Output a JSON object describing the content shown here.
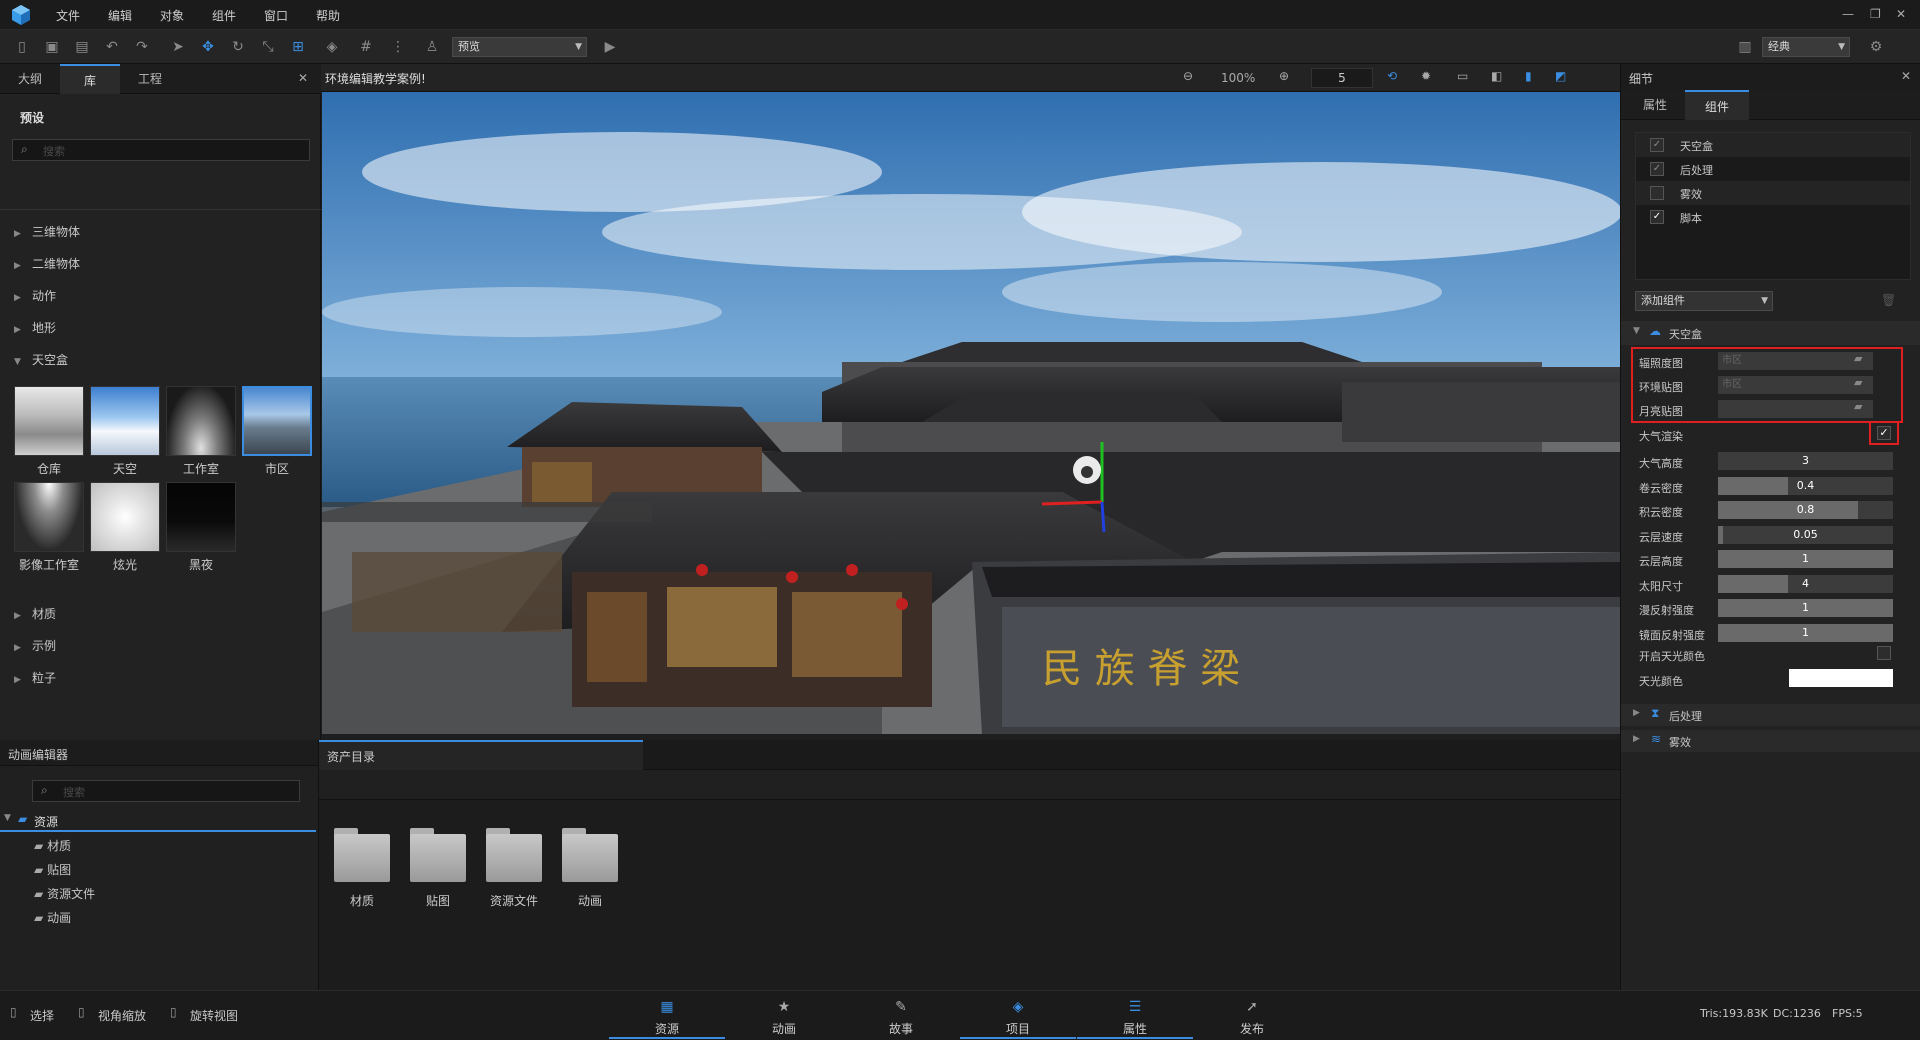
{
  "menubar": {
    "items": [
      "文件",
      "编辑",
      "对象",
      "组件",
      "窗口",
      "帮助"
    ]
  },
  "toolbar": {
    "preview_dropdown": "预览",
    "layout_dropdown": "经典"
  },
  "left_panel": {
    "tabs": [
      "大纲",
      "库",
      "工程"
    ],
    "section_title": "预设",
    "search_placeholder": "搜索",
    "categories_top": [
      "三维物体",
      "二维物体",
      "动作",
      "地形",
      "天空盒"
    ],
    "skybox_items": [
      "仓库",
      "天空",
      "工作室",
      "市区",
      "影像工作室",
      "炫光",
      "黑夜"
    ],
    "categories_bottom": [
      "材质",
      "示例",
      "粒子"
    ]
  },
  "viewport": {
    "title": "环境编辑教学案例!",
    "zoom": "100%",
    "speed": "5",
    "sign_text": "民 族 脊 梁"
  },
  "anim_editor": {
    "title": "动画编辑器",
    "search_placeholder": "搜索",
    "tree_root": "资源",
    "tree_children": [
      "材质",
      "贴图",
      "资源文件",
      "动画"
    ]
  },
  "assets": {
    "title": "资产目录",
    "folders": [
      "材质",
      "贴图",
      "资源文件",
      "动画"
    ]
  },
  "right_panel": {
    "title": "细节",
    "tabs": [
      "属性",
      "组件"
    ],
    "components": [
      {
        "label": "天空盒",
        "checked": true
      },
      {
        "label": "后处理",
        "checked": true
      },
      {
        "label": "雾效",
        "checked": false
      },
      {
        "label": "脚本",
        "checked": true
      }
    ],
    "add_component": "添加组件",
    "skybox_section": "天空盒",
    "files": [
      {
        "label": "辐照度图",
        "value": "市区"
      },
      {
        "label": "环境贴图",
        "value": "市区"
      },
      {
        "label": "月亮贴图",
        "value": ""
      }
    ],
    "atmosphere_label": "大气渲染",
    "sliders": [
      {
        "label": "大气高度",
        "value": "3",
        "fraction": 0.0
      },
      {
        "label": "卷云密度",
        "value": "0.4",
        "fraction": 0.4
      },
      {
        "label": "积云密度",
        "value": "0.8",
        "fraction": 0.8
      },
      {
        "label": "云层速度",
        "value": "0.05",
        "fraction": 0.03
      },
      {
        "label": "云层高度",
        "value": "1",
        "fraction": 1.0
      },
      {
        "label": "太阳尺寸",
        "value": "4",
        "fraction": 0.4
      },
      {
        "label": "漫反射强度",
        "value": "1",
        "fraction": 1.0
      },
      {
        "label": "镜面反射强度",
        "value": "1",
        "fraction": 1.0
      }
    ],
    "skylight_label": "开启天光颜色",
    "skycolor_label": "天光颜色",
    "collapsed": [
      "后处理",
      "雾效"
    ]
  },
  "statusbar": {
    "left": [
      "选择",
      "视角缩放",
      "旋转视图"
    ],
    "tabs": [
      "资源",
      "动画",
      "故事",
      "项目",
      "属性",
      "发布"
    ],
    "stats": {
      "tris": "Tris:193.83K",
      "dc": "DC:1236",
      "fps": "FPS:5"
    }
  },
  "colors": {
    "accent": "#3a8de0",
    "highlight": "#e02020",
    "panel": "#222222"
  }
}
